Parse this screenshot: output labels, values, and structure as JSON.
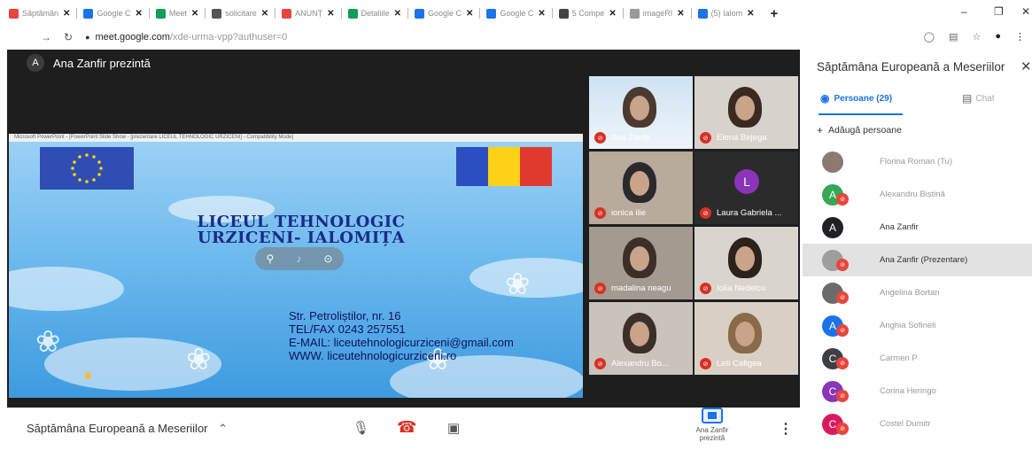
{
  "browser": {
    "tabs": [
      {
        "title": "Săptămân",
        "color": "#e8453c"
      },
      {
        "title": "Google C",
        "color": "#1a73e8"
      },
      {
        "title": "Meet",
        "color": "#0f9d58"
      },
      {
        "title": "solicitare",
        "color": "#555555"
      },
      {
        "title": "ANUNȚ",
        "color": "#e8453c"
      },
      {
        "title": "Detaliile",
        "color": "#0f9d58"
      },
      {
        "title": "Google C",
        "color": "#1a73e8"
      },
      {
        "title": "Google C",
        "color": "#1a73e8"
      },
      {
        "title": "5 Compe",
        "color": "#444444"
      },
      {
        "title": "imageRI",
        "color": "#999999"
      },
      {
        "title": "(5) Ialom",
        "color": "#1a73e8"
      }
    ],
    "url_host": "meet.google.com",
    "url_path": "/xde-urma-vpp?authuser=0"
  },
  "meeting": {
    "presenter_initial": "A",
    "presenter_label": "Ana Zanfir prezintă",
    "title": "Săptămâna Europeană a Meseriilor",
    "presenting_label": "Ana Zanfir prezintă"
  },
  "slide": {
    "window_caption": "Microsoft PowerPoint - [PowerPoint Slide Show - [prezentare LICEUL TEHNOLOGIC URZICENI] - Compatibility Mode]",
    "title_line1": "LICEUL TEHNOLOGIC",
    "title_line2": "URZICENI- IALOMIȚA",
    "address": "Str. Petroliștilor, nr. 16",
    "phone": "TEL/FAX 0243 257551",
    "email": "E-MAIL: liceutehnologicurziceni@gmail.com",
    "web": "WWW. liceutehnologicurziceni.ro"
  },
  "tiles": [
    {
      "name": "Ana Zanfir"
    },
    {
      "name": "Elena Bejega"
    },
    {
      "name": "ionica ilie"
    },
    {
      "name": "Laura Gabriela ...",
      "initial": "L"
    },
    {
      "name": "madalina neagu"
    },
    {
      "name": "Iolia Nedelcu"
    },
    {
      "name": "Alexandru Bo..."
    },
    {
      "name": "Leti Cafigea"
    }
  ],
  "panel": {
    "title": "Săptămâna Europeană a Meseriilor",
    "tab_people": "Persoane (29)",
    "tab_chat": "Chat",
    "add_people": "Adăugă persoane",
    "people": [
      {
        "name": "Florina Roman (Tu)",
        "initial": "",
        "color": "#8a7a70",
        "muted": false
      },
      {
        "name": "Alexandru Biștină",
        "initial": "A",
        "color": "#34a853",
        "muted": true
      },
      {
        "name": "Ana Zanfir",
        "initial": "A",
        "color": "#202124",
        "muted": false
      },
      {
        "name": "Ana Zanfir (Prezentare)",
        "initial": "",
        "color": "#9e9e9e",
        "muted": true
      },
      {
        "name": "Angelina Bortan",
        "initial": "",
        "color": "#6b6b6b",
        "muted": true
      },
      {
        "name": "Anghia Sofineli",
        "initial": "A",
        "color": "#1a73e8",
        "muted": true
      },
      {
        "name": "Carmen P",
        "initial": "C",
        "color": "#3c4043",
        "muted": true
      },
      {
        "name": "Corina Heringo",
        "initial": "C",
        "color": "#8a34b8",
        "muted": true
      },
      {
        "name": "Costel Dumitr",
        "initial": "C",
        "color": "#d81b60",
        "muted": true
      }
    ]
  }
}
